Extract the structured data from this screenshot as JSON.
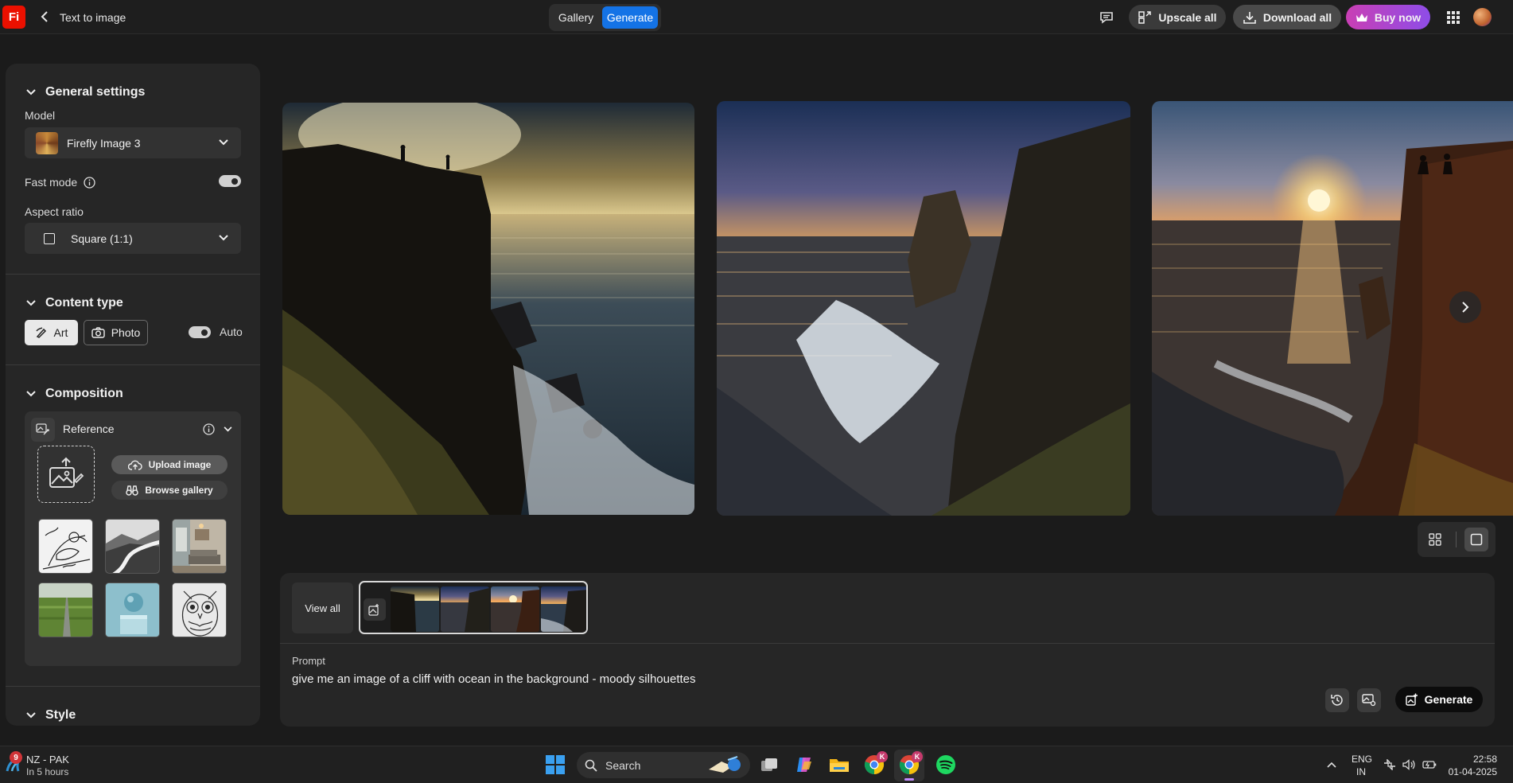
{
  "header": {
    "logo_text": "Fi",
    "title": "Text to image",
    "tabs": [
      {
        "label": "Gallery",
        "active": false
      },
      {
        "label": "Generate",
        "active": true
      }
    ],
    "upscale_label": "Upscale all",
    "download_label": "Download all",
    "buy_label": "Buy now",
    "accent_color": "#1473e6"
  },
  "sidebar": {
    "general": {
      "title": "General settings",
      "model_label": "Model",
      "model_value": "Firefly Image 3",
      "fast_mode_label": "Fast mode",
      "fast_mode_on": true,
      "aspect_label": "Aspect ratio",
      "aspect_value": "Square (1:1)"
    },
    "content_type": {
      "title": "Content type",
      "art_label": "Art",
      "photo_label": "Photo",
      "auto_label": "Auto",
      "selected": "Art"
    },
    "composition": {
      "title": "Composition",
      "reference_label": "Reference",
      "upload_label": "Upload image",
      "browse_label": "Browse gallery",
      "thumbnails": [
        "bird-sketch",
        "winding-road-mono",
        "living-room",
        "green-road",
        "sphere-pedestal",
        "owl-sketch"
      ]
    },
    "style": {
      "title": "Style"
    }
  },
  "gallery": {
    "images": [
      "cliff-silhouettes-sunburst",
      "cliff-canyon-sunset",
      "cliff-figures-sunset"
    ]
  },
  "prompt": {
    "view_all_label": "View all",
    "label": "Prompt",
    "text": "give me an image of a cliff with ocean in the background - moody silhouettes",
    "generate_label": "Generate"
  },
  "taskbar": {
    "weather_badge": "9",
    "weather_title": "NZ - PAK",
    "weather_sub": "In 5 hours",
    "search_label": "Search",
    "chrome_badge": "K",
    "lang_line1": "ENG",
    "lang_line2": "IN",
    "time": "22:58",
    "date": "01-04-2025"
  }
}
